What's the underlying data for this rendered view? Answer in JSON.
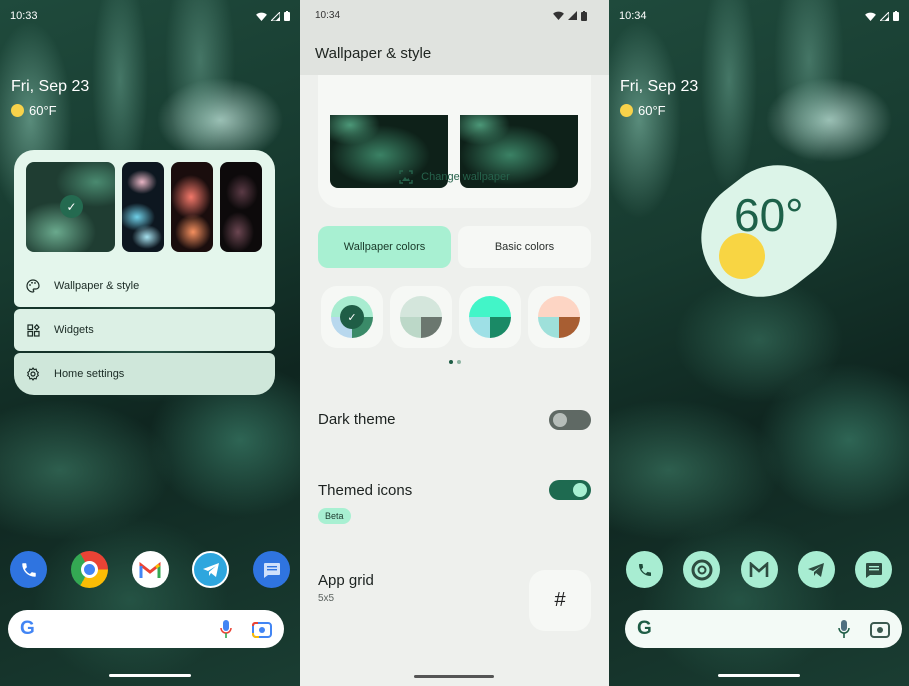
{
  "screen1": {
    "status": {
      "time": "10:33"
    },
    "date": "Fri, Sep 23",
    "weather": {
      "temp": "60°F",
      "icon": "sun-icon"
    },
    "wallpaper_thumbs": [
      {
        "name": "agave-green",
        "selected": true
      },
      {
        "name": "jellyfish"
      },
      {
        "name": "coral-flower"
      },
      {
        "name": "dark-flowers"
      }
    ],
    "menu": [
      {
        "label": "Wallpaper & style",
        "icon": "palette-icon"
      },
      {
        "label": "Widgets",
        "icon": "widgets-icon"
      },
      {
        "label": "Home settings",
        "icon": "gear-icon"
      }
    ],
    "dock": [
      "Phone",
      "Chrome",
      "Gmail",
      "Telegram",
      "Messages"
    ]
  },
  "screen2": {
    "status": {
      "time": "10:34"
    },
    "title": "Wallpaper & style",
    "change_wallpaper": "Change wallpaper",
    "tabs": [
      {
        "label": "Wallpaper colors",
        "active": true
      },
      {
        "label": "Basic colors",
        "active": false
      }
    ],
    "swatches": [
      {
        "top": "#a8ecd0",
        "bl": "#b8d8ee",
        "br": "#3a8a68",
        "selected": true
      },
      {
        "top": "#d4e6dc",
        "bl": "#bcd8c8",
        "br": "#6b776f",
        "selected": false
      },
      {
        "top": "#42f5c8",
        "bl": "#9ee0e6",
        "br": "#1a8a66",
        "selected": false
      },
      {
        "top": "#fdd5c4",
        "bl": "#9ee0da",
        "br": "#a85e32",
        "selected": false
      }
    ],
    "page_dots": {
      "current": 1,
      "total": 2
    },
    "dark_theme": {
      "label": "Dark theme",
      "enabled": false
    },
    "themed_icons": {
      "label": "Themed icons",
      "enabled": true,
      "badge": "Beta"
    },
    "app_grid": {
      "label": "App grid",
      "value": "5x5",
      "icon": "#"
    }
  },
  "screen3": {
    "status": {
      "time": "10:34"
    },
    "date": "Fri, Sep 23",
    "weather": {
      "temp": "60°F"
    },
    "weather_widget": {
      "temp": "60°"
    },
    "dock": [
      "Phone",
      "Chrome",
      "Gmail",
      "Telegram",
      "Messages"
    ]
  }
}
